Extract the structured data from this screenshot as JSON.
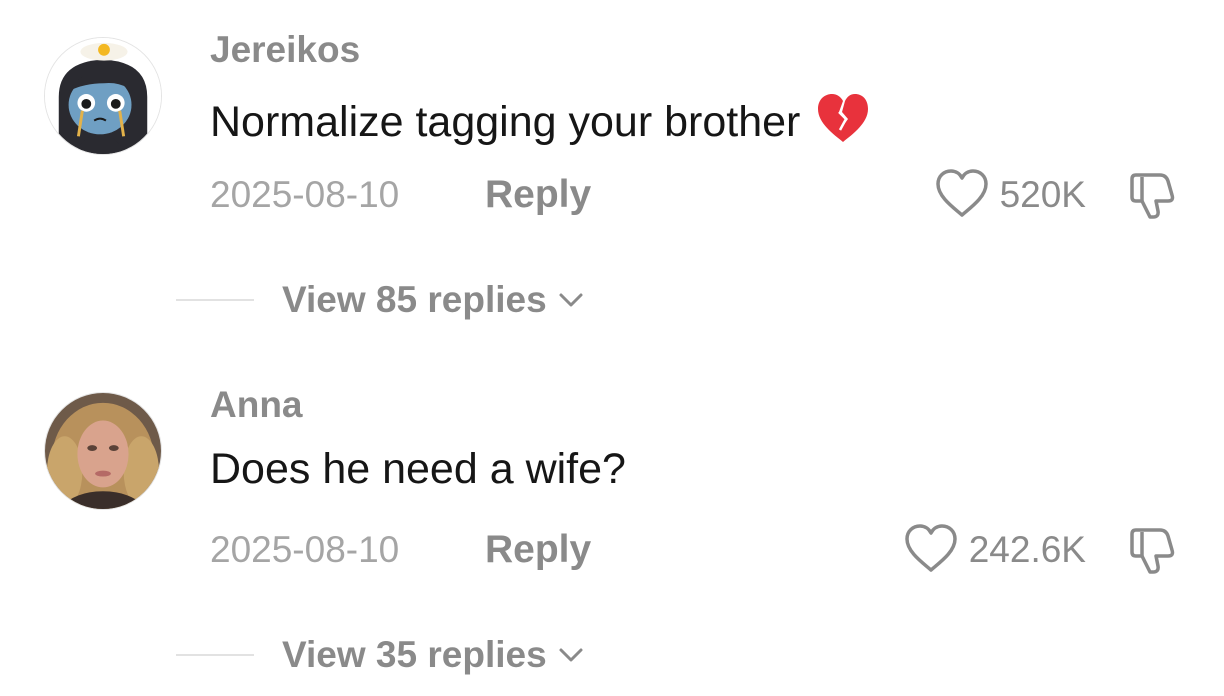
{
  "comments": [
    {
      "username": "Jereikos",
      "text": "Normalize tagging your brother",
      "emoji": "broken-heart-icon",
      "date": "2025-08-10",
      "reply_label": "Reply",
      "like_count": "520K",
      "view_replies_label": "View 85 replies",
      "avatar": "cartoon-crying-character-with-fried-egg"
    },
    {
      "username": "Anna",
      "text": "Does he need a wife?",
      "date": "2025-08-10",
      "reply_label": "Reply",
      "like_count": "242.6K",
      "view_replies_label": "View 35 replies",
      "avatar": "woman-with-blonde-curly-hair"
    }
  ],
  "colors": {
    "text_primary": "#161616",
    "text_secondary": "#8a8a8a",
    "text_tertiary": "#a5a5a5",
    "divider": "#e2e2e2",
    "emoji_red": "#e8323c"
  }
}
